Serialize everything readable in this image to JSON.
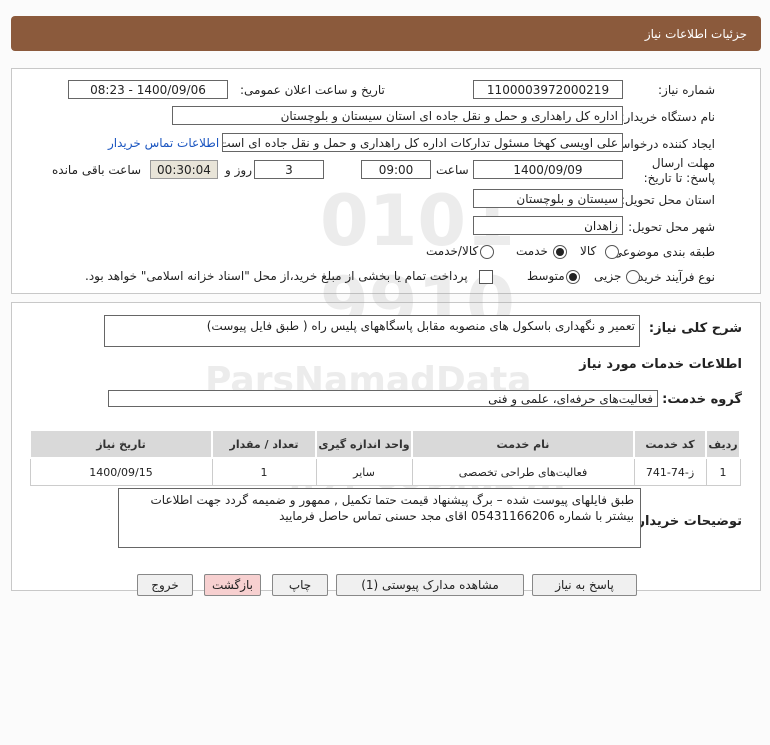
{
  "header": {
    "title": "جزئیات اطلاعات نیاز"
  },
  "fields": {
    "need_number_label": "شماره نیاز:",
    "need_number": "1100003972000219",
    "announce_label": "تاریخ و ساعت اعلان عمومی:",
    "announce_value": "1400/09/06 - 08:23",
    "buyer_label": "نام دستگاه خریدار:",
    "buyer_value": "اداره کل راهداری و حمل و نقل جاده ای استان سیستان و بلوچستان",
    "creator_label": "ایجاد کننده درخواست:",
    "creator_value": "علی اویسی کهخا مسئول تدارکات اداره کل راهداری و حمل و نقل جاده ای است",
    "contact_link": "اطلاعات تماس خریدار",
    "deadline_label": "مهلت ارسال پاسخ: تا تاریخ:",
    "deadline_date": "1400/09/09",
    "time_label": "ساعت",
    "deadline_time": "09:00",
    "days_value": "3",
    "days_label": "روز و",
    "remaining_value": "00:30:04",
    "remaining_label": "ساعت باقی مانده",
    "province_label": "استان محل تحویل:",
    "province_value": "سیستان و بلوچستان",
    "city_label": "شهر محل تحویل:",
    "city_value": "زاهدان",
    "category_label": "طبقه بندی موضوعی:",
    "category_options": [
      "کالا",
      "خدمت",
      "کالا/خدمت"
    ],
    "category_selected": "خدمت",
    "process_label": "نوع فرآیند خرید :",
    "process_options": [
      "جزیی",
      "متوسط"
    ],
    "process_selected": "متوسط",
    "payment_note": "پرداخت تمام یا بخشی از مبلغ خرید،از محل \"اسناد خزانه اسلامی\" خواهد بود."
  },
  "general": {
    "summary_label": "شرح کلی نیاز:",
    "summary_value": "تعمیر و نگهداری باسکول های منصوبه مقابل پاسگاههای پلیس راه ( طبق فایل پیوست)",
    "services_title": "اطلاعات خدمات مورد نیاز",
    "group_label": "گروه خدمت:",
    "group_value": "فعالیت‌های حرفه‌ای، علمی و فنی"
  },
  "table": {
    "headers": [
      "ردیف",
      "کد خدمت",
      "نام خدمت",
      "واحد اندازه گیری",
      "تعداد / مقدار",
      "تاریخ نیاز"
    ],
    "rows": [
      [
        "1",
        "ز-74-741",
        "فعالیت‌های طراحی تخصصی",
        "سایر",
        "1",
        "1400/09/15"
      ]
    ]
  },
  "buyer_notes": {
    "label": "توضیحات خریدار:",
    "text": "طبق فایلهای پیوست شده – برگ پیشنهاد قیمت حتما تکمیل , ممهور و ضمیمه گردد جهت اطلاعات بیشتر با شماره 05431166206 اقای مجد حسنی تماس حاصل فرمایید"
  },
  "buttons": {
    "reply": "پاسخ به نیاز",
    "attachments": "مشاهده مدارک پیوستی (1)",
    "print": "چاپ",
    "back": "بازگشت",
    "exit": "خروج"
  },
  "colors": {
    "header": "#8b5a3c",
    "link": "#1a55c0",
    "back_button": "#f7d0d0"
  }
}
